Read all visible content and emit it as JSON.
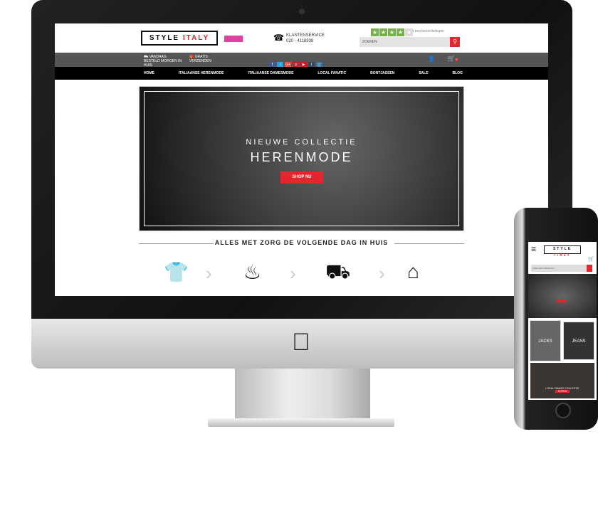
{
  "site": {
    "logo": {
      "word1": "STYLE",
      "word2": "ITALY"
    },
    "customer_service": {
      "label": "KLANTENSERVICE",
      "phone": "020 - 4118938"
    },
    "reviews": {
      "stars": 4,
      "max_stars": 5,
      "label": "Lees beoordelingen"
    },
    "search": {
      "placeholder": "ZOEKEN"
    },
    "usp": [
      {
        "icon": "truck-icon",
        "text": "VANDAAG BESTELD MORGEN IN HUIS"
      },
      {
        "icon": "gift-icon",
        "text": "GRATIS VERZENDEN"
      }
    ],
    "social": [
      {
        "label": "f",
        "color": "#3b5998"
      },
      {
        "label": "t",
        "color": "#1da1f2"
      },
      {
        "label": "G+",
        "color": "#dd4b39"
      },
      {
        "label": "p",
        "color": "#cb2027"
      },
      {
        "label": "▶",
        "color": "#cc181e"
      },
      {
        "label": "t",
        "color": "#35465c"
      },
      {
        "label": "◻",
        "color": "#3f729b"
      }
    ],
    "cart_count": "0",
    "nav": [
      "HOME",
      "ITALIAANSE HERENMODE",
      "ITALIAANSE DAMESMODE",
      "LOCAL FANATIC",
      "BONTJASSEN",
      "SALE",
      "BLOG"
    ],
    "hero": {
      "line1": "NIEUWE COLLECTIE",
      "line2": "HERENMODE",
      "button": "SHOP NU"
    },
    "tagline": "ALLES MET ZORG DE VOLGENDE DAG IN HUIS",
    "accent": "#e3262d"
  },
  "mobile": {
    "search_placeholder": "ZOEK EEN PRODUCT",
    "tiles": [
      "JACKS",
      "JEANS",
      "LOCAL FANATIC COLLECTIE"
    ],
    "tile_button": "KOPEN"
  }
}
